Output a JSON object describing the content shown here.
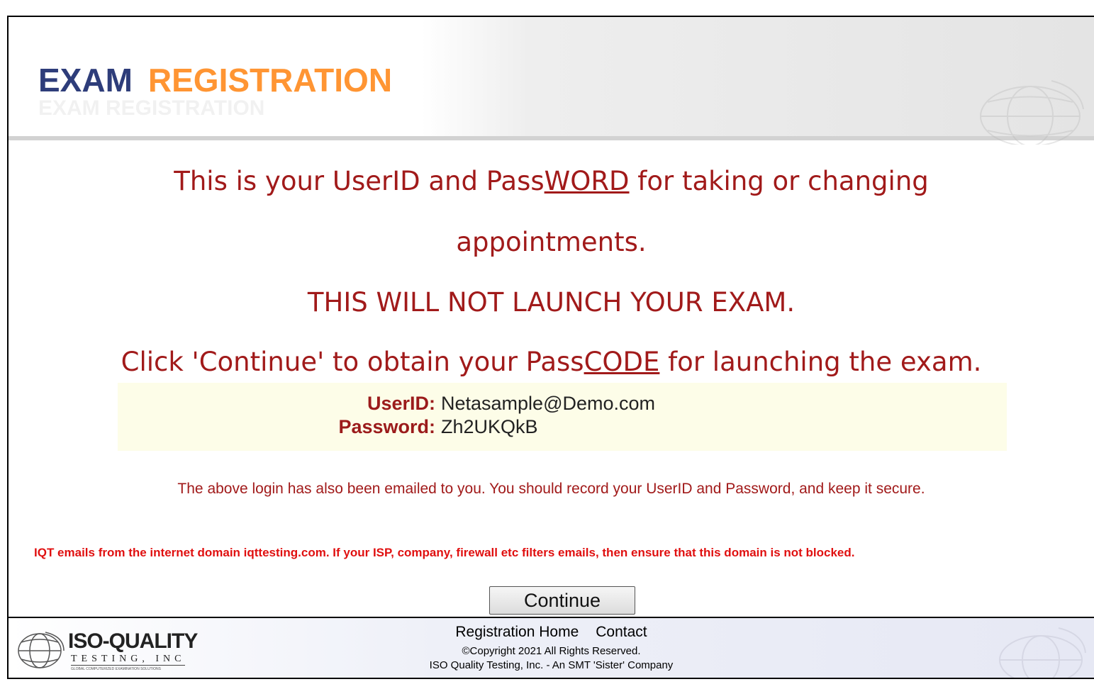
{
  "header": {
    "title_part1": "EXAM",
    "title_part2": "REGISTRATION",
    "ghost_text": "EXAM REGISTRATION"
  },
  "messages": {
    "line1_pre": "This is your UserID and Pass",
    "line1_underlined": "WORD",
    "line1_post": " for taking or changing",
    "line2": "appointments.",
    "line3": "THIS WILL NOT LAUNCH YOUR EXAM.",
    "line4_pre": "Click 'Continue' to obtain your Pass",
    "line4_underlined": "CODE",
    "line4_post": " for launching the exam."
  },
  "credentials": {
    "userid_label": "UserID:",
    "userid_value": "Netasample@Demo.com",
    "password_label": "Password:",
    "password_value": "Zh2UKQkB"
  },
  "notes": {
    "emailed": "The above login has also been emailed to you. You should record your UserID and Password, and keep it secure.",
    "domain_warning": "IQT emails from the internet domain iqttesting.com. If your ISP, company, firewall etc filters emails, then ensure that this domain is not blocked."
  },
  "actions": {
    "continue_label": "Continue"
  },
  "footer": {
    "logo_name": "ISO-QUALITY",
    "logo_sub": "TESTING, INC",
    "logo_tagline": "GLOBAL COMPUTERIZED EXAMINATION SOLUTIONS",
    "link_home": "Registration Home",
    "link_contact": "Contact",
    "copyright": "©Copyright 2021 All Rights Reserved.",
    "company": "ISO Quality Testing, Inc. - An SMT 'Sister' Company"
  },
  "colors": {
    "title_navy": "#2e3d7a",
    "title_orange": "#ff9533",
    "message_red": "#a11a1a",
    "warning_red": "#e01010",
    "cred_bg": "#fdfde8"
  }
}
